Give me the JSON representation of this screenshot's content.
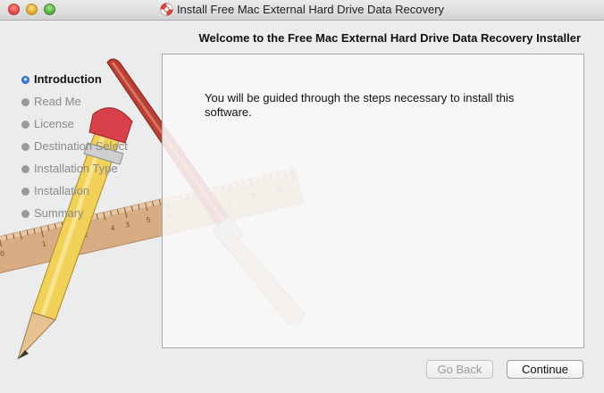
{
  "window": {
    "title": "Install Free Mac External Hard Drive Data Recovery"
  },
  "header": {
    "title": "Welcome to the Free Mac External Hard Drive Data Recovery Installer"
  },
  "steps": [
    {
      "label": "Introduction",
      "active": true
    },
    {
      "label": "Read Me",
      "active": false
    },
    {
      "label": "License",
      "active": false
    },
    {
      "label": "Destination Select",
      "active": false
    },
    {
      "label": "Installation Type",
      "active": false
    },
    {
      "label": "Installation",
      "active": false
    },
    {
      "label": "Summary",
      "active": false
    }
  ],
  "content": {
    "text": "You will be guided through the steps necessary to install this software."
  },
  "buttons": {
    "back_label": "Go Back",
    "continue_label": "Continue"
  },
  "ruler": {
    "numbers": [
      "0",
      "1",
      "2",
      "3",
      "4",
      "5",
      "6",
      "7",
      "8",
      "9",
      "10"
    ]
  },
  "icons": {
    "title_icon": "installer-lifebuoy-icon",
    "background_art": "pencil-brush-ruler-illustration"
  },
  "colors": {
    "active_step": "#2a6cc8",
    "inactive_step": "#9a9a9a"
  }
}
